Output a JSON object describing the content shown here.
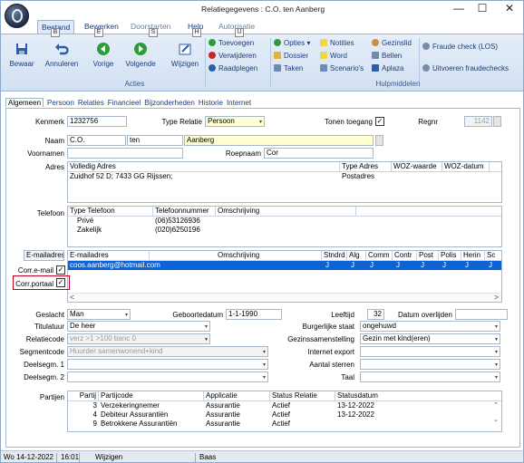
{
  "window": {
    "title": "Relatiegegevens : C.O. ten Aanberg",
    "minimize": "—",
    "maximize": "☐",
    "close": "✕"
  },
  "ribbon_tabs": [
    {
      "label": "Bestand",
      "key": "B"
    },
    {
      "label": "Bewerken",
      "key": "E"
    },
    {
      "label": "Doorstarten",
      "key": "S"
    },
    {
      "label": "Help",
      "key": "H"
    },
    {
      "label": "Autorisatie",
      "key": "U"
    }
  ],
  "ribbon": {
    "bewaar": "Bewaar",
    "annuleren": "Annuleren",
    "vorige": "Vorige",
    "volgende": "Volgende",
    "wijzigen": "Wijzigen",
    "toevoegen": "Toevoegen",
    "verwijderen": "Verwijderen",
    "raadplegen": "Raadplegen",
    "acties_group": "Acties",
    "opties": "Opties",
    "notities": "Notities",
    "gezinslid": "Gezinslid",
    "dossier": "Dossier",
    "word": "Word",
    "bellen": "Bellen",
    "taken": "Taken",
    "scenarios": "Scenario's",
    "aplaza": "Aplaza",
    "fraude_check": "Fraude check (LOS)",
    "uitvoeren_fraude": "Uitvoeren fraudechecks",
    "hulpmiddelen_group": "Hulpmiddelen"
  },
  "form_tabs": [
    "Algemeen",
    "Persoon",
    "Relaties",
    "Financieel",
    "Bijzonderheden",
    "Historie",
    "Internet"
  ],
  "form": {
    "kenmerk_label": "Kenmerk",
    "kenmerk": "1232756",
    "type_relatie_label": "Type Relatie",
    "type_relatie": "Persoon",
    "tonen_toegang_label": "Tonen toegang",
    "regnr_label": "Regnr",
    "regnr": "1142",
    "naam_label": "Naam",
    "naam_voorletters": "C.O.",
    "naam_tussenvoegsel": "ten",
    "naam_achternaam": "Aanberg",
    "voornamen_label": "Voornamen",
    "voornamen": "",
    "roepnaam_label": "Roepnaam",
    "roepnaam": "Cor",
    "adres_label": "Adres",
    "adres_headers": [
      "Volledig Adres",
      "Type Adres",
      "WOZ-waarde",
      "WOZ-datum"
    ],
    "adres_rows": [
      [
        "Zuidhof 52 D; 7433 GG Rijssen;",
        "Postadres",
        "",
        ""
      ]
    ],
    "telefoon_label": "Telefoon",
    "telefoon_headers": [
      "Type Telefoon",
      "Telefoonnummer",
      "Omschrijving"
    ],
    "telefoon_rows": [
      [
        "Privé",
        "(06)53126936",
        ""
      ],
      [
        "Zakelijk",
        "(020)6250196",
        ""
      ]
    ],
    "emailadres_button": "E-mailadres",
    "email_headers": [
      "E-mailadres",
      "Omschrijving",
      "Stndrd",
      "Alg",
      "Comm",
      "Contr",
      "Post",
      "Polis",
      "Herin",
      "Sc"
    ],
    "email_rows": [
      [
        "coos.aanberg@hotmail.com",
        "",
        "J",
        "J",
        "J",
        "J",
        "J",
        "J",
        "J",
        "J"
      ]
    ],
    "corr_email_label": "Corr.e-mail",
    "corr_portaal_label": "Corr.portaal",
    "scroll_left": "<",
    "scroll_right": ">",
    "geslacht_label": "Geslacht",
    "geslacht": "Man",
    "geboortedatum_label": "Geboortedatum",
    "geboortedatum": "1-1-1990",
    "leeftijd_label": "Leeftijd",
    "leeftijd": "32",
    "datum_overlijden_label": "Datum overlijden",
    "datum_overlijden": "",
    "titulatuur_label": "Titulatuur",
    "titulatuur": "De heer",
    "burgerlijke_staat_label": "Burgerlijke staat",
    "burgerlijke_staat": "ongehuwd",
    "relatiecode_label": "Relatiecode",
    "relatiecode": "verz >1 >100 banc 0",
    "gezinssamenstelling_label": "Gezinssamenstelling",
    "gezinssamenstelling": "Gezin met kind(eren)",
    "segmentcode_label": "Segmentcode",
    "segmentcode": "Huurder samenwonend+kind",
    "internet_export_label": "Internet export",
    "internet_export": "",
    "deelsegm1_label": "Deelsegm. 1",
    "deelsegm1": "",
    "aantal_sterren_label": "Aantal sterren",
    "aantal_sterren": "",
    "deelsegm2_label": "Deelsegm. 2",
    "deelsegm2": "",
    "taal_label": "Taal",
    "taal": "",
    "partijen_label": "Partijen",
    "partijen_headers": [
      "Partij",
      "Partijcode",
      "Applicatie",
      "Status Relatie",
      "Statusdatum"
    ],
    "partijen_rows": [
      [
        "3",
        "Verzekeringnemer",
        "Assurantie",
        "Actief",
        "13-12-2022"
      ],
      [
        "4",
        "Debiteur Assurantiën",
        "Assurantie",
        "Actief",
        "13-12-2022"
      ],
      [
        "9",
        "Betrokkene Assurantiën",
        "Assurantie",
        "Actief",
        ""
      ]
    ]
  },
  "status_bar": {
    "date": "Wo 14-12-2022",
    "time": "16:01",
    "mode": "Wijzigen",
    "user": "Baas"
  },
  "colors": {
    "accent": "#1a3d7c",
    "highlight_border": "#c0001a",
    "selected_row": "#0a64d8"
  }
}
